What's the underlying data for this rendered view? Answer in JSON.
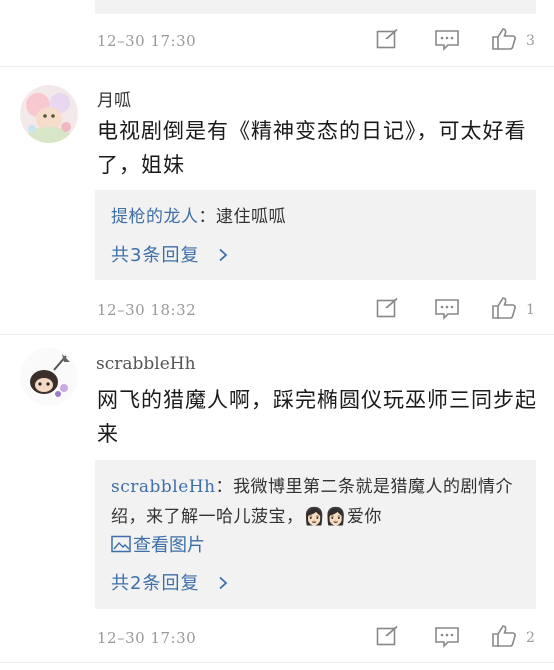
{
  "top_comment": {
    "time": "12–30  17:30",
    "like_count": "3"
  },
  "comment_1": {
    "username": "月呱",
    "content": "电视剧倒是有《精神变态的日记》，可太好看了，姐妹",
    "reply_author": "提枪的龙人",
    "reply_sep": "：",
    "reply_text": "逮住呱呱",
    "more_replies": "共3条回复",
    "time": "12–30  18:32",
    "like_count": "1"
  },
  "comment_2": {
    "username": "scrabbleHh",
    "content": "网飞的猎魔人啊，踩完椭圆仪玩巫师三同步起来",
    "reply_author": "scrabbleHh",
    "reply_sep": "：",
    "reply_text": "我微博里第二条就是猎魔人的剧情介绍，来了解一哈儿菠宝，",
    "reply_emoji": "👩🏻👩🏻",
    "reply_tail": "爱你",
    "view_image": "查看图片",
    "more_replies": "共2条回复",
    "time": "12–30  17:30",
    "like_count": "2"
  },
  "icons": [
    "edit-icon",
    "comment-icon",
    "like-icon",
    "chevron-right-icon",
    "image-icon"
  ],
  "colors": {
    "link": "#3e6fa8",
    "muted": "#999999",
    "reply_bg": "#f2f2f2"
  }
}
